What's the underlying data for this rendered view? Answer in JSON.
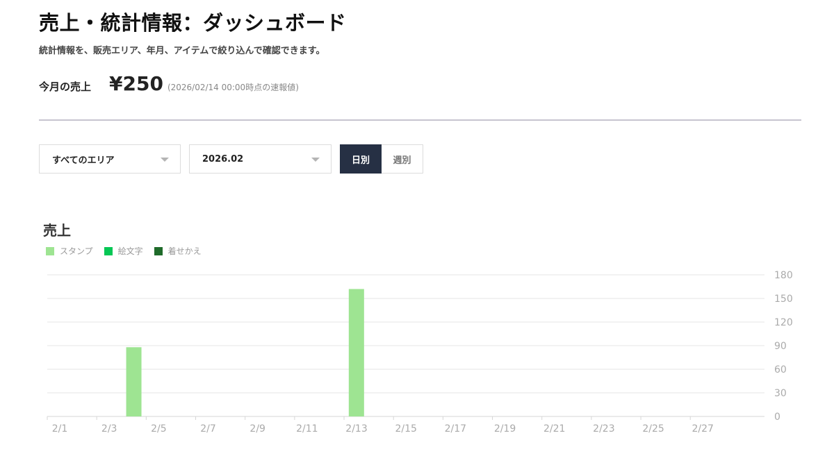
{
  "header": {
    "title": "売上・統計情報：ダッシュボード",
    "subtitle": "統計情報を、販売エリア、年月、アイテムで絞り込んで確認できます。"
  },
  "monthly_sales": {
    "label": "今月の売上",
    "value": "¥250",
    "note": "(2026/02/14 00:00時点の速報値)"
  },
  "filters": {
    "area_value": "すべてのエリア",
    "month_value": "2026.02",
    "period_options": [
      {
        "label": "日別",
        "active": true
      },
      {
        "label": "週別",
        "active": false
      }
    ]
  },
  "chart_section": {
    "title": "売上"
  },
  "colors": {
    "stamp": "#9ee492",
    "emoji": "#06c755",
    "theme": "#1f6b2a",
    "toggle_active_bg": "#263044"
  },
  "chart_data": {
    "type": "bar",
    "stacked": true,
    "x": [
      "2/1",
      "2/2",
      "2/3",
      "2/4",
      "2/5",
      "2/6",
      "2/7",
      "2/8",
      "2/9",
      "2/10",
      "2/11",
      "2/12",
      "2/13",
      "2/14",
      "2/15",
      "2/16",
      "2/17",
      "2/18",
      "2/19",
      "2/20",
      "2/21",
      "2/22",
      "2/23",
      "2/24",
      "2/25",
      "2/26",
      "2/27",
      "2/28"
    ],
    "x_tick_labels": [
      "2/1",
      "2/3",
      "2/5",
      "2/7",
      "2/9",
      "2/11",
      "2/13",
      "2/15",
      "2/17",
      "2/19",
      "2/21",
      "2/23",
      "2/25",
      "2/27"
    ],
    "series": [
      {
        "name": "スタンプ",
        "color": "#9ee492",
        "values": [
          0,
          0,
          0,
          88,
          0,
          0,
          0,
          0,
          0,
          0,
          0,
          0,
          162,
          0,
          0,
          0,
          0,
          0,
          0,
          0,
          0,
          0,
          0,
          0,
          0,
          0,
          0,
          0
        ]
      },
      {
        "name": "絵文字",
        "color": "#06c755",
        "values": [
          0,
          0,
          0,
          0,
          0,
          0,
          0,
          0,
          0,
          0,
          0,
          0,
          0,
          0,
          0,
          0,
          0,
          0,
          0,
          0,
          0,
          0,
          0,
          0,
          0,
          0,
          0,
          0
        ]
      },
      {
        "name": "着せかえ",
        "color": "#1f6b2a",
        "values": [
          0,
          0,
          0,
          0,
          0,
          0,
          0,
          0,
          0,
          0,
          0,
          0,
          0,
          0,
          0,
          0,
          0,
          0,
          0,
          0,
          0,
          0,
          0,
          0,
          0,
          0,
          0,
          0
        ]
      }
    ],
    "yticks": [
      0,
      30,
      60,
      90,
      120,
      150,
      180
    ],
    "ylim": [
      0,
      180
    ],
    "y_axis_position": "right",
    "grid": true,
    "legend": "top-left"
  }
}
